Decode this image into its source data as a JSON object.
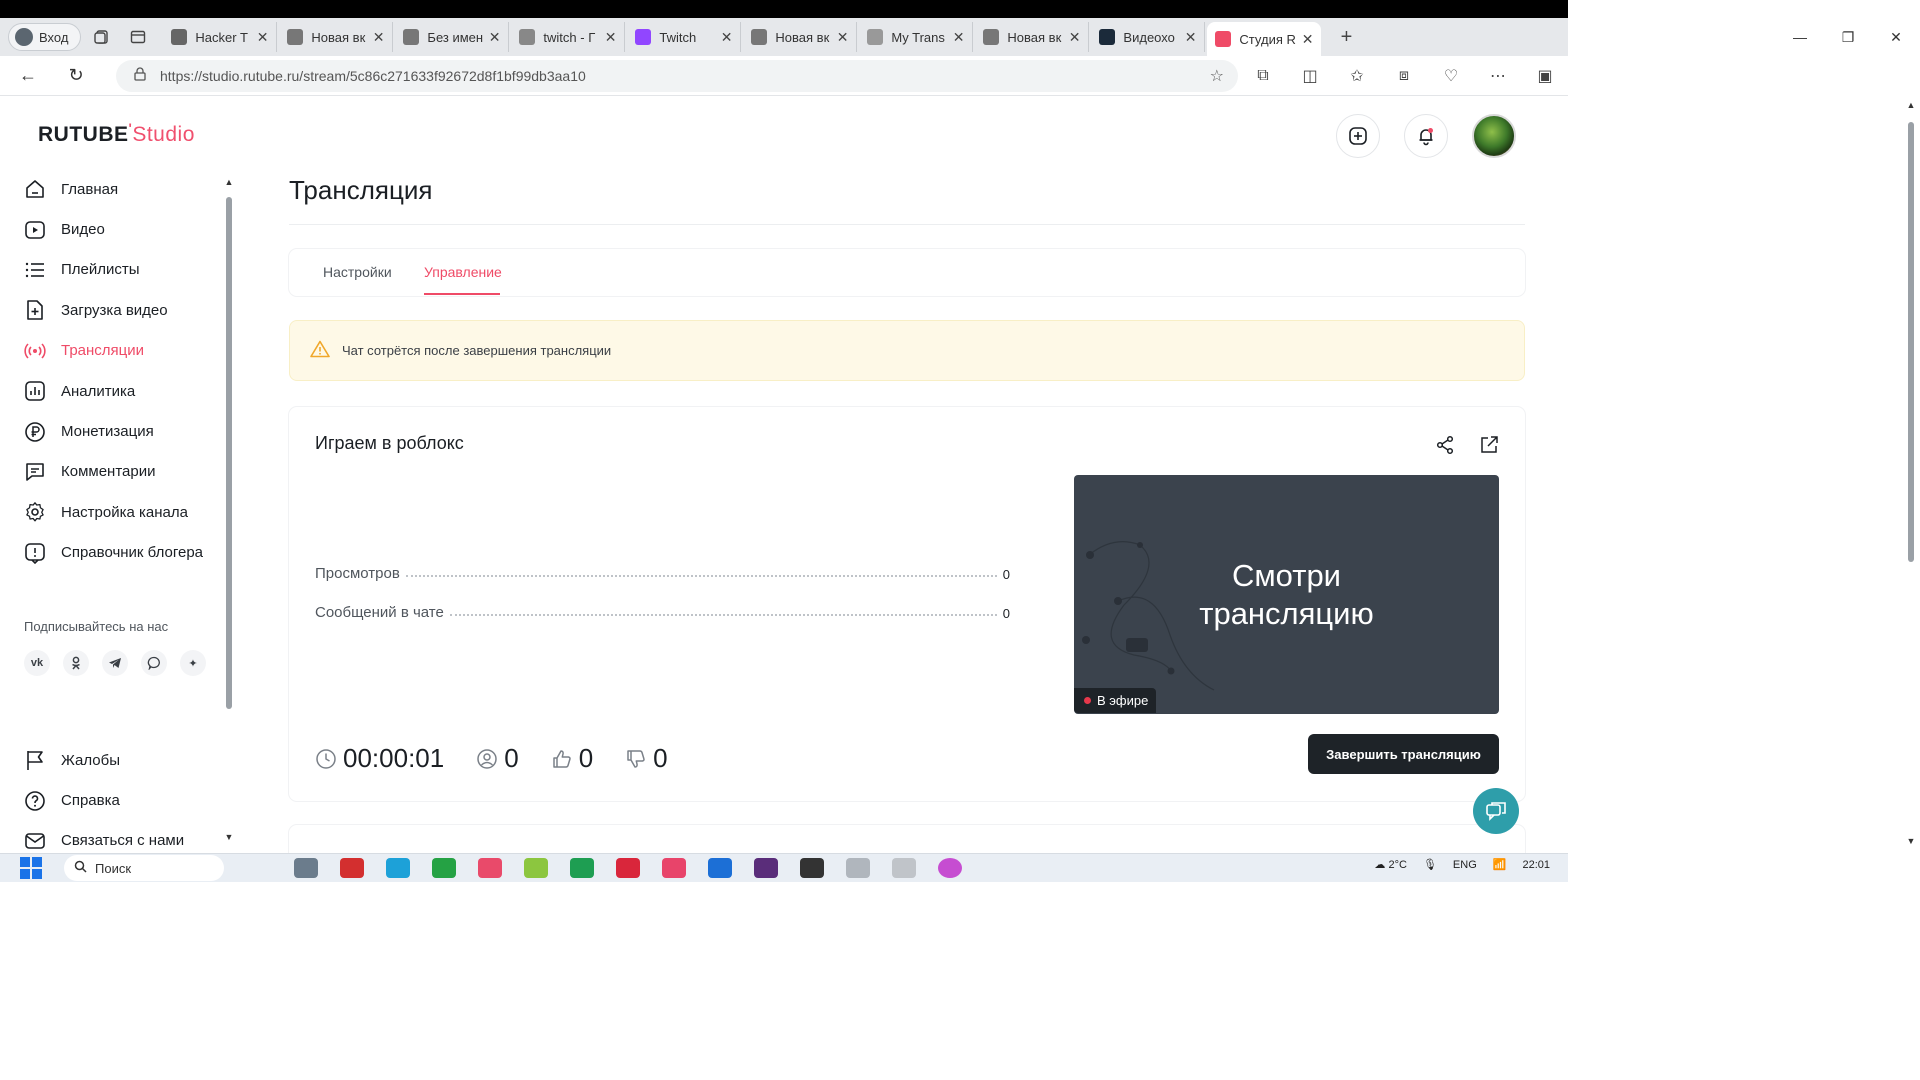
{
  "browser": {
    "profile_label": "Вход",
    "tabs": [
      {
        "label": "Hacker T",
        "color": "#666"
      },
      {
        "label": "Новая вк",
        "color": "#777"
      },
      {
        "label": "Без имен",
        "color": "#777"
      },
      {
        "label": "twitch - Г",
        "color": "#888"
      },
      {
        "label": "Twitch",
        "color": "#9146ff"
      },
      {
        "label": "Новая вк",
        "color": "#777"
      },
      {
        "label": "My Trans",
        "color": "#999"
      },
      {
        "label": "Новая вк",
        "color": "#777"
      },
      {
        "label": "Видеохо",
        "color": "#1b2a3a"
      },
      {
        "label": "Студия R",
        "color": "#ef4b67"
      }
    ],
    "url": "https://studio.rutube.ru/stream/5c86c271633f92672d8f1bf99db3aa10"
  },
  "sidebar": {
    "logo_main": "RUTUBE",
    "logo_studio": "Studio",
    "items": [
      {
        "label": "Главная",
        "icon": "home-icon"
      },
      {
        "label": "Видео",
        "icon": "video-icon"
      },
      {
        "label": "Плейлисты",
        "icon": "playlist-icon"
      },
      {
        "label": "Загрузка видео",
        "icon": "upload-icon"
      },
      {
        "label": "Трансляции",
        "icon": "broadcast-icon"
      },
      {
        "label": "Аналитика",
        "icon": "analytics-icon"
      },
      {
        "label": "Монетизация",
        "icon": "ruble-icon"
      },
      {
        "label": "Комментарии",
        "icon": "comments-icon"
      },
      {
        "label": "Настройка канала",
        "icon": "gear-icon"
      },
      {
        "label": "Справочник блогера",
        "icon": "info-icon"
      }
    ],
    "follow_label": "Подписывайтесь на нас",
    "socials": [
      "vk",
      "ok",
      "telegram",
      "viber",
      "zen"
    ],
    "bottom_items": [
      {
        "label": "Жалобы",
        "icon": "flag-icon"
      },
      {
        "label": "Справка",
        "icon": "help-icon"
      },
      {
        "label": "Связаться с нами",
        "icon": "mail-icon"
      }
    ]
  },
  "main": {
    "page_title": "Трансляция",
    "tabs": [
      {
        "label": "Настройки"
      },
      {
        "label": "Управление"
      }
    ],
    "warning_text": "Чат сотрётся после завершения трансляции",
    "stream": {
      "title": "Играем в роблокс",
      "stats": [
        {
          "label": "Просмотров",
          "value": "0"
        },
        {
          "label": "Сообщений в чате",
          "value": "0"
        }
      ],
      "preview_line1": "Смотри",
      "preview_line2": "трансляцию",
      "live_label": "В эфире",
      "timer": "00:00:01",
      "viewers": "0",
      "likes": "0",
      "dislikes": "0",
      "end_button": "Завершить трансляцию"
    }
  },
  "taskbar": {
    "search_placeholder": "Поиск",
    "weather": "2°C",
    "lang": "ENG",
    "time": "22:01"
  },
  "colors": {
    "accent": "#ef4b67",
    "dark_button": "#1e2328",
    "warning_bg": "#fef9e7",
    "fab": "#2e9eaa"
  }
}
